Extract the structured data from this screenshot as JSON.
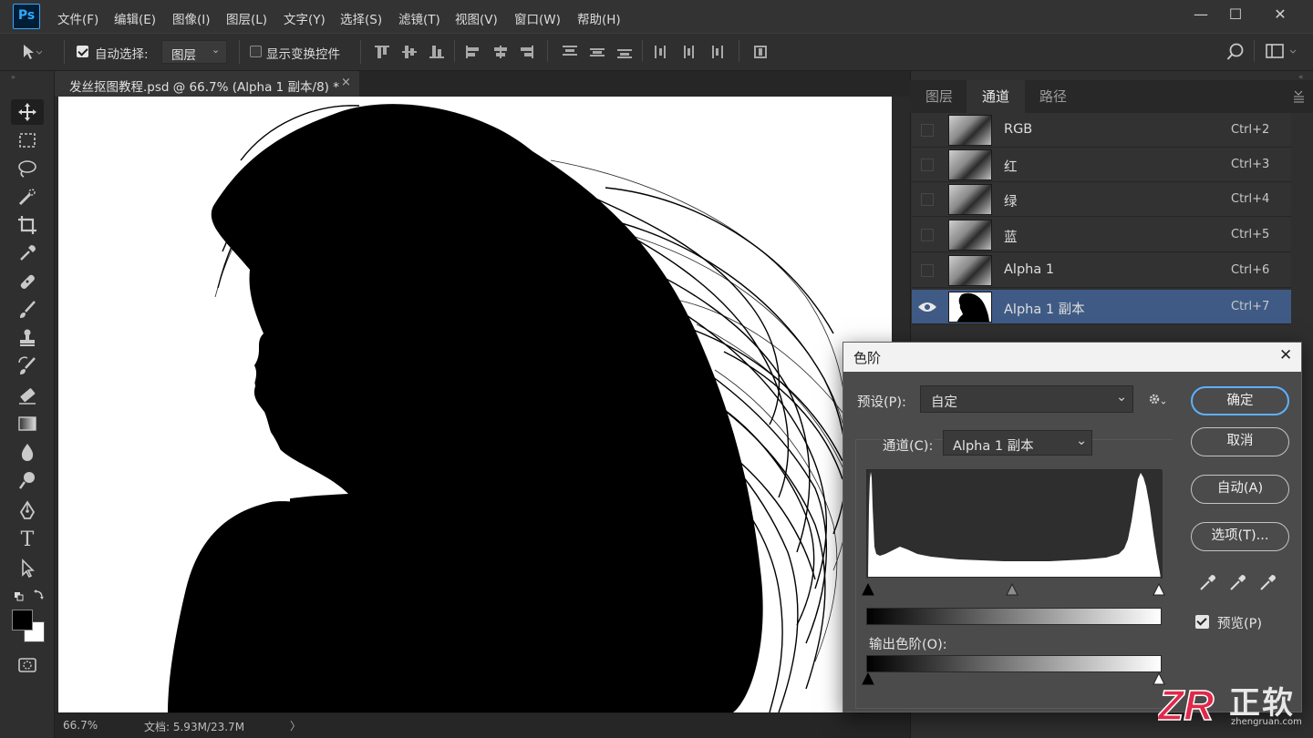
{
  "app": {
    "logo": "Ps"
  },
  "menu": [
    "文件(F)",
    "编辑(E)",
    "图像(I)",
    "图层(L)",
    "文字(Y)",
    "选择(S)",
    "滤镜(T)",
    "视图(V)",
    "窗口(W)",
    "帮助(H)"
  ],
  "window_controls": {
    "minimize": "—",
    "maximize": "☐",
    "close": "✕"
  },
  "options_bar": {
    "auto_select_label": "自动选择:",
    "auto_select_checked": true,
    "auto_select_target": "图层",
    "show_transform_label": "显示变换控件",
    "show_transform_checked": false
  },
  "document": {
    "tab_title": "发丝抠图教程.psd @ 66.7% (Alpha 1 副本/8) *",
    "close_glyph": "×"
  },
  "status": {
    "zoom": "66.7%",
    "doc_info": "文档: 5.93M/23.7M",
    "arrow": "〉"
  },
  "panel": {
    "tabs": [
      "图层",
      "通道",
      "路径"
    ],
    "active_tab": "通道",
    "channels": [
      {
        "name": "RGB",
        "shortcut": "Ctrl+2",
        "visible": false,
        "selected": false
      },
      {
        "name": "红",
        "shortcut": "Ctrl+3",
        "visible": false,
        "selected": false
      },
      {
        "name": "绿",
        "shortcut": "Ctrl+4",
        "visible": false,
        "selected": false
      },
      {
        "name": "蓝",
        "shortcut": "Ctrl+5",
        "visible": false,
        "selected": false
      },
      {
        "name": "Alpha 1",
        "shortcut": "Ctrl+6",
        "visible": false,
        "selected": false
      },
      {
        "name": "Alpha 1 副本",
        "shortcut": "Ctrl+7",
        "visible": true,
        "selected": true
      }
    ]
  },
  "levels_dialog": {
    "title": "色阶",
    "close_glyph": "✕",
    "preset_label": "预设(P):",
    "preset_value": "自定",
    "channel_label": "通道(C):",
    "channel_value": "Alpha 1 副本",
    "output_label": "输出色阶(O):",
    "buttons": {
      "ok": "确定",
      "cancel": "取消",
      "auto": "自动(A)",
      "options": "选项(T)..."
    },
    "preview_label": "预览(P)",
    "preview_checked": true
  },
  "watermark": {
    "brand": "ZR",
    "text": "正软",
    "url": "zhengruan.com"
  },
  "colors": {
    "selection": "#3f5b85",
    "accent_ring": "#5fb0ff",
    "ps_blue": "#31a8ff",
    "watermark_red": "#e0294a"
  }
}
